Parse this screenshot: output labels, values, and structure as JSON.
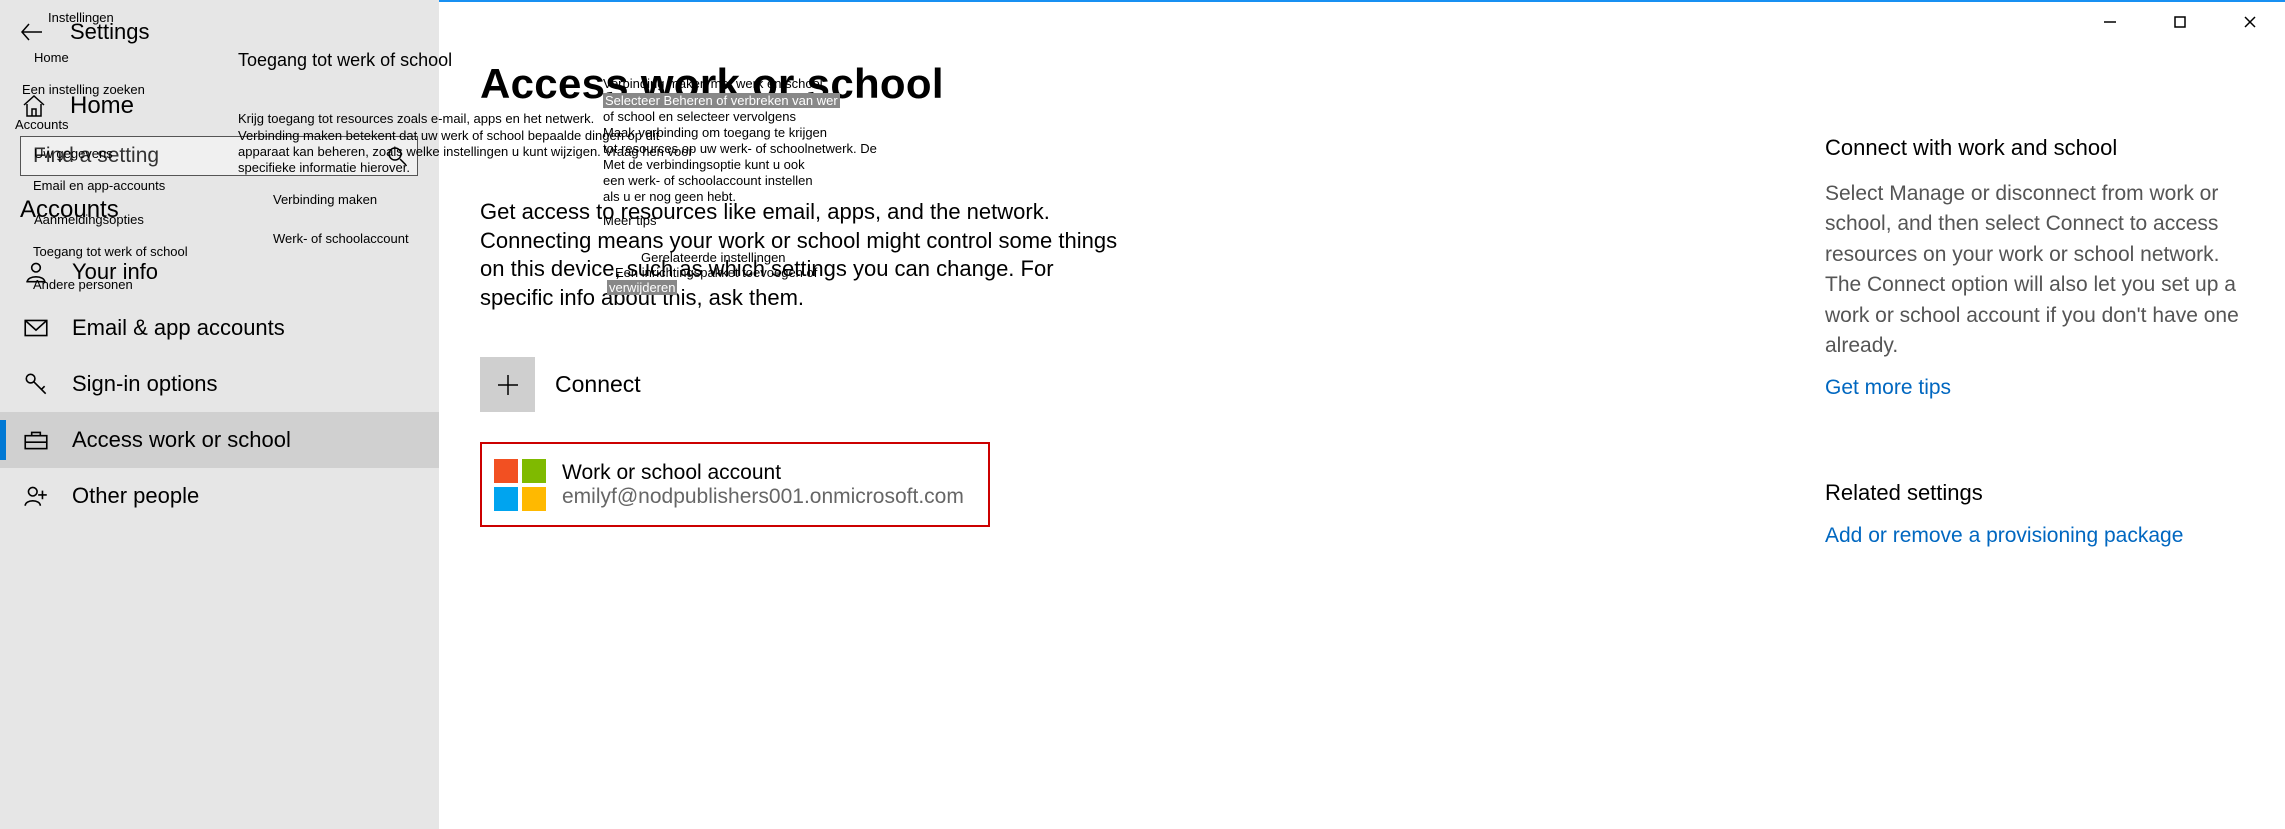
{
  "window": {
    "app_title": "Settings"
  },
  "sidebar": {
    "home": "Home",
    "search_placeholder": "Find a setting",
    "category": "Accounts",
    "items": [
      {
        "label": "Your info"
      },
      {
        "label": "Email & app accounts"
      },
      {
        "label": "Sign-in options"
      },
      {
        "label": "Access work or school"
      },
      {
        "label": "Other people"
      }
    ]
  },
  "main": {
    "title": "Access work or school",
    "description": "Get access to resources like email, apps, and the network. Connecting means your work or school might control some things on this device, such as which settings you can change. For specific info about this, ask them.",
    "connect_label": "+  Connect",
    "connect_text": "Connect",
    "account": {
      "title": "Work or school account",
      "email": "emilyf@nodpublishers001.onmicrosoft.com"
    }
  },
  "right": {
    "heading1": "Connect with work and school",
    "body1": "Select Manage or disconnect from work or school, and then select Connect to access resources on your work or school network. The Connect option will also let you set up a work or school account if you don't have one already.",
    "link1": "Get more tips",
    "heading2": "Related settings",
    "link2": "Add or remove a provisioning package"
  },
  "overlays": {
    "nl_settings": "Instellingen",
    "nl_home": "Home",
    "nl_find": "Een instelling zoeken",
    "nl_accounts": "Accounts",
    "nl_yourinfo": "Uw gegevens",
    "nl_email": "Email en app-accounts",
    "nl_signin": "Aanmeldingsopties",
    "nl_access": "Toegang tot werk of school",
    "nl_other": "Andere personen",
    "nl_title": "Toegang tot werk of school",
    "nl_desc1": "Krijg toegang tot resources zoals e-mail, apps en het netwerk.",
    "nl_desc2": "Verbinding maken betekent dat uw werk of school bepaalde dingen op dit",
    "nl_desc3": "apparaat kan beheren, zoals welke instellingen u kunt wijzigen. Vraag hen voor",
    "nl_desc4": "specifieke informatie hierover.",
    "nl_connect": "Verbinding maken",
    "nl_ws": "Werk- of schoolaccount",
    "nl_r1": "Verbinding maken met werk en school",
    "nl_r2": "Selecteer Beheren of verbreken van wer",
    "nl_r3": "of school en selecteer vervolgens",
    "nl_r4": "Maak verbinding om toegang te krijgen",
    "nl_r5": "tot resources op uw werk- of schoolnetwerk. De",
    "nl_r6": "Met de verbindingsoptie kunt u ook",
    "nl_r7": "een werk- of schoolaccount instellen",
    "nl_r8": "als u er nog geen hebt.",
    "nl_r9": "Meer tips",
    "nl_rel": "Gerelateerde instellingen",
    "nl_link2a": "Een inrichtingspakket toevoegen of",
    "nl_link2b": "verwijderen"
  }
}
